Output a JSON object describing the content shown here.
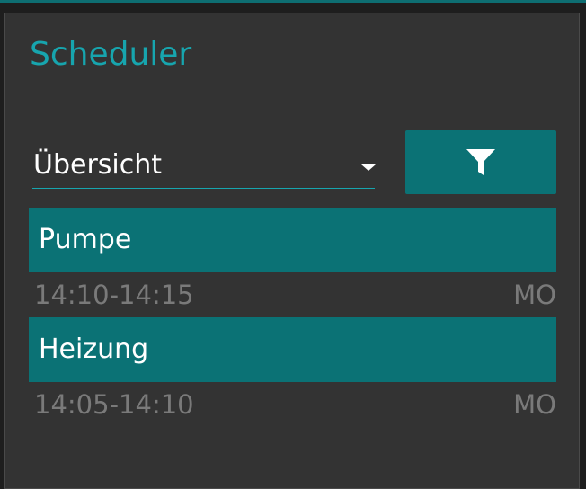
{
  "scheduler": {
    "title": "Scheduler",
    "view_select": {
      "value": "Übersicht"
    },
    "filter_button": {
      "icon": "filter-icon"
    },
    "entries": [
      {
        "name": "Pumpe",
        "time": "14:10-14:15",
        "day": "MO"
      },
      {
        "name": "Heizung",
        "time": "14:05-14:10",
        "day": "MO"
      }
    ]
  },
  "colors": {
    "accent": "#17a5ae",
    "bar": "#0b7275",
    "panel": "#333333",
    "muted_text": "#7a7a7a"
  }
}
